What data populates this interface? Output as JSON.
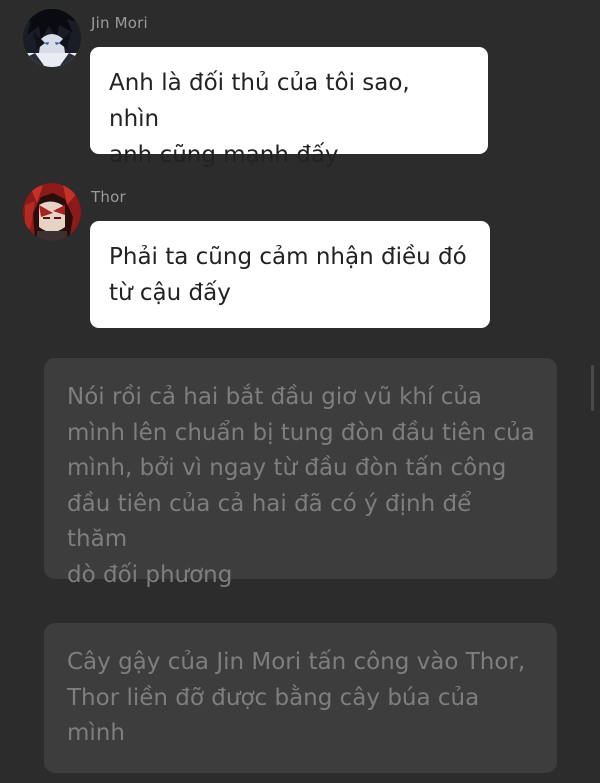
{
  "messages": [
    {
      "sender": "Jin Mori",
      "text": "Anh là đối thủ của tôi sao, nhìn\nanh cũng mạnh đấy"
    },
    {
      "sender": "Thor",
      "text": "Phải ta cũng cảm nhận điều đó\ntừ cậu đấy"
    }
  ],
  "narrations": [
    {
      "text": "Nói rồi cả hai bắt đầu giơ vũ khí của\nmình lên chuẩn bị tung đòn đầu tiên của\nmình, bởi vì ngay từ đầu đòn tấn công\nđầu tiên của cả hai đã có ý định để thăm\ndò đối phương"
    },
    {
      "text": "Cây gậy của Jin Mori tấn công vào Thor,\nThor liền đỡ được bằng cây búa của\nmình"
    }
  ],
  "avatars": {
    "jin_mori": "avatar-jin-mori",
    "thor": "avatar-thor"
  },
  "colors": {
    "background": "#2c2c2c",
    "bubble": "#ffffff",
    "bubble_text": "#222222",
    "narration_bg": "#3d3d3d",
    "narration_text": "#7e7e7e",
    "sender_text": "#9a9a9a"
  }
}
